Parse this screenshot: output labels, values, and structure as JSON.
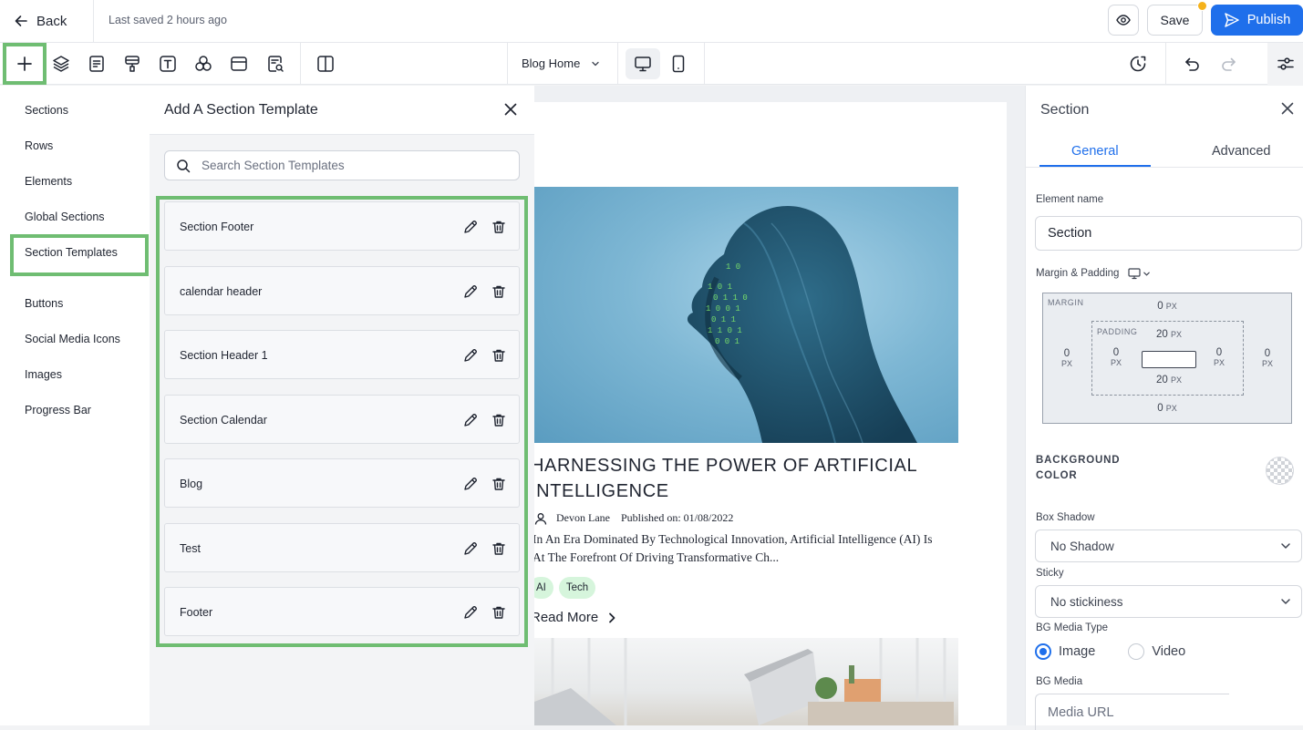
{
  "topbar": {
    "back_label": "Back",
    "saved_status": "Last saved 2 hours ago",
    "save_label": "Save",
    "publish_label": "Publish",
    "accent_color": "#1f6feb",
    "unsaved_dot_color": "#f5b21b"
  },
  "toolbar": {
    "icons": [
      "plus-icon",
      "layers-icon",
      "page-icon",
      "paint-roller-icon",
      "text-icon",
      "elements-icon",
      "browser-icon",
      "seo-search-icon",
      "split-view-icon"
    ],
    "page_selector": "Blog Home",
    "devices": [
      "desktop-icon",
      "mobile-icon"
    ],
    "right_icons": [
      "history-icon",
      "undo-icon",
      "redo-icon",
      "settings-sliders-icon"
    ]
  },
  "leftnav": {
    "items": [
      {
        "label": "Sections"
      },
      {
        "label": "Rows"
      },
      {
        "label": "Elements"
      },
      {
        "label": "Global Sections"
      },
      {
        "label": "Section Templates"
      },
      {
        "label": "Buttons"
      },
      {
        "label": "Social Media Icons"
      },
      {
        "label": "Images"
      },
      {
        "label": "Progress Bar"
      }
    ],
    "selected": "Section Templates",
    "highlight_color": "#6fbd72"
  },
  "templates_panel": {
    "title": "Add A Section Template",
    "search_placeholder": "Search Section Templates",
    "items": [
      {
        "label": "Section Footer"
      },
      {
        "label": "calendar header"
      },
      {
        "label": "Section Header 1"
      },
      {
        "label": "Section Calendar"
      },
      {
        "label": "Blog"
      },
      {
        "label": "Test"
      },
      {
        "label": "Footer"
      }
    ]
  },
  "canvas": {
    "post_title_line1": "HARNESSING THE POWER OF ARTIFICIAL",
    "post_title_line2": "INTELLIGENCE",
    "author": "Devon Lane",
    "published": "Published on: 01/08/2022",
    "excerpt_line1": "In An Era Dominated By Technological Innovation, Artificial Intelligence (AI) Is",
    "excerpt_line2": "At The Forefront Of Driving Transformative Ch...",
    "tags": [
      "AI",
      "Tech"
    ],
    "read_more": "Read More",
    "tag_color": "#d6f5dc"
  },
  "properties": {
    "title": "Section",
    "tabs": [
      "General",
      "Advanced"
    ],
    "active_tab": "General",
    "element_name_label": "Element name",
    "element_name_value": "Section",
    "margin_padding_label": "Margin & Padding",
    "box_model": {
      "margin_caption": "MARGIN",
      "padding_caption": "PADDING",
      "unit": "PX",
      "margin_top": "0",
      "margin_bottom": "0",
      "margin_left": "0",
      "margin_right": "0",
      "padding_top": "20",
      "padding_bottom": "20",
      "padding_left": "0",
      "padding_right": "0"
    },
    "background_color_label_line1": "BACKGROUND",
    "background_color_label_line2": "COLOR",
    "box_shadow_label": "Box Shadow",
    "box_shadow_value": "No Shadow",
    "sticky_label": "Sticky",
    "sticky_value": "No stickiness",
    "bg_media_type_label": "BG Media Type",
    "bg_media_options": [
      "Image",
      "Video"
    ],
    "bg_media_selected": "Image",
    "bg_media_label": "BG Media",
    "media_url_placeholder": "Media URL"
  }
}
